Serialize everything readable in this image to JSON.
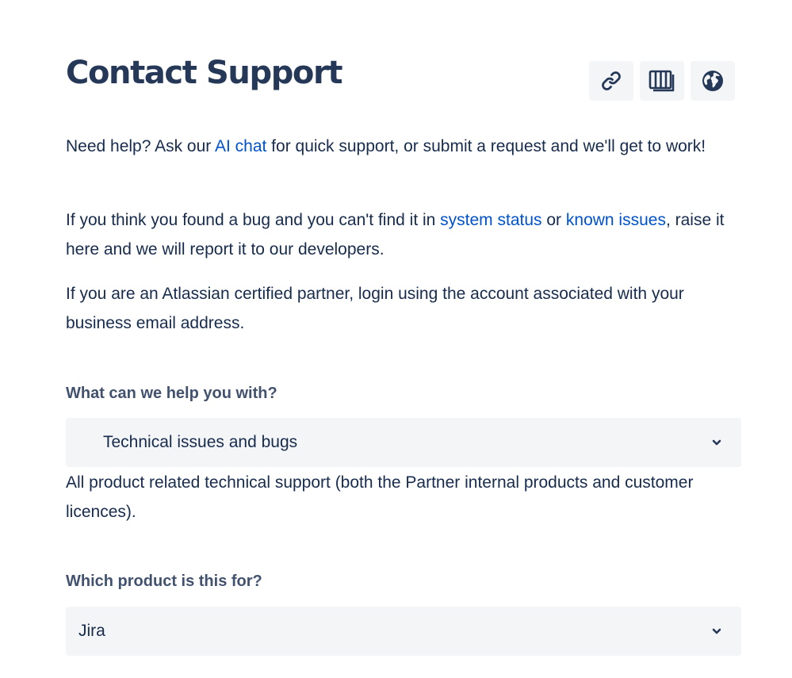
{
  "page": {
    "title": "Contact Support"
  },
  "toolbar": {
    "buttons": [
      {
        "icon": "link-icon"
      },
      {
        "icon": "columns-icon"
      },
      {
        "icon": "globe-icon"
      }
    ]
  },
  "intro": {
    "p1_before": "Need help? Ask our ",
    "p1_link": "AI chat",
    "p1_after": " for quick support, or submit a request and we'll get to work!",
    "p2_before": "If you think you found a bug and you can't find it in ",
    "p2_link1": "system status",
    "p2_mid": " or ",
    "p2_link2": "known issues",
    "p2_after": ", raise it here and we will report it to our developers.",
    "p3": "If you are an Atlassian certified partner, login using the account associated with your business email address."
  },
  "form": {
    "help_with": {
      "label": "What can we help you with?",
      "value": "Technical issues and bugs",
      "description": "All product related technical support (both the Partner internal products and customer licences)."
    },
    "product": {
      "label": "Which product is this for?",
      "value": "Jira"
    }
  },
  "colors": {
    "title": "#253858",
    "text": "#172B4D",
    "link": "#0052CC",
    "label": "#42526E",
    "field_bg": "#F4F5F7"
  }
}
